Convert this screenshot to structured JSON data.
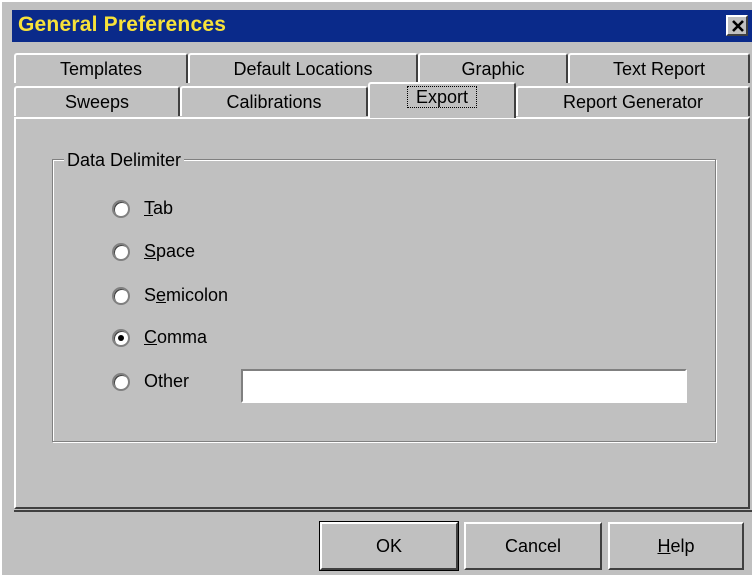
{
  "window": {
    "title": "General Preferences",
    "close_glyph": "×"
  },
  "tabs_back": [
    {
      "label": "Templates"
    },
    {
      "label": "Default Locations"
    },
    {
      "label": "Graphic"
    },
    {
      "label": "Text Report"
    }
  ],
  "tabs_front": [
    {
      "label": "Sweeps"
    },
    {
      "label": "Calibrations"
    },
    {
      "label": "Export",
      "active": true
    },
    {
      "label": "Report Generator"
    }
  ],
  "group": {
    "title": "Data Delimiter",
    "options": [
      {
        "prefix": "",
        "mnemonic": "T",
        "rest": "ab",
        "checked": false
      },
      {
        "prefix": "",
        "mnemonic": "S",
        "rest": "pace",
        "checked": false
      },
      {
        "prefix": "S",
        "mnemonic": "e",
        "rest": "micolon",
        "checked": false
      },
      {
        "prefix": "",
        "mnemonic": "C",
        "rest": "omma",
        "checked": true
      },
      {
        "prefix": "",
        "mnemonic": "O",
        "rest": "ther",
        "checked": false
      }
    ],
    "other_value": ""
  },
  "buttons": {
    "ok": {
      "prefix": "",
      "mnemonic": "O",
      "rest": "K"
    },
    "cancel": {
      "label": "Cancel"
    },
    "help": {
      "prefix": "",
      "mnemonic": "H",
      "rest": "elp"
    }
  }
}
